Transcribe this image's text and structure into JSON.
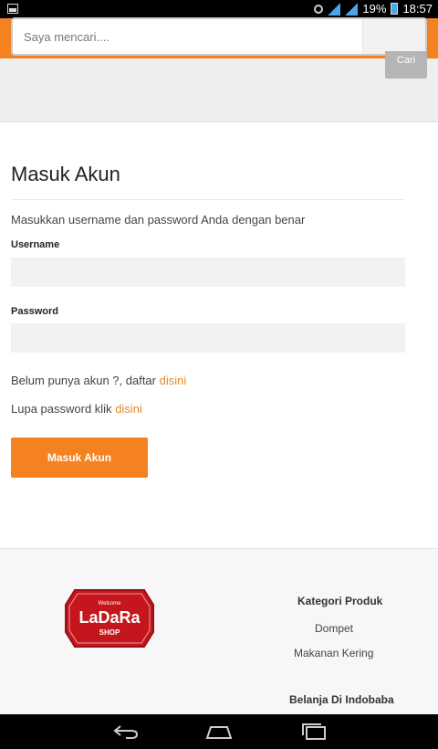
{
  "status_bar": {
    "battery": "19%",
    "time": "18:57",
    "icons": [
      "image-icon",
      "sync-icon",
      "signal-icon",
      "battery-icon"
    ]
  },
  "header": {
    "menu_icon": "hamburger-icon",
    "logo_icon": "logo-icon",
    "cart_icon": "cart-icon",
    "accent_color": "#f58220"
  },
  "search": {
    "placeholder": "Saya mencari....",
    "button_label": "Cari"
  },
  "login": {
    "title": "Masuk Akun",
    "instruction": "Masukkan username dan password Anda dengan benar",
    "username_label": "Username",
    "username_value": "",
    "password_label": "Password",
    "password_value": "",
    "register_text": "Belum punya akun ?, daftar",
    "register_link": "disini",
    "forgot_text": "Lupa password klik",
    "forgot_link": "disini",
    "submit_label": "Masuk Akun",
    "link_color": "#e0892c"
  },
  "footer": {
    "badge": {
      "top_text": "Welcome",
      "main_text": "LaDaRa",
      "bottom_text": "SHOP"
    },
    "categories_heading": "Kategori Produk",
    "categories": [
      "Dompet",
      "Makanan Kering"
    ],
    "shop_heading": "Belanja Di Indobaba"
  },
  "nav_bar": {
    "icons": [
      "back-icon",
      "home-icon",
      "recent-apps-icon"
    ]
  }
}
